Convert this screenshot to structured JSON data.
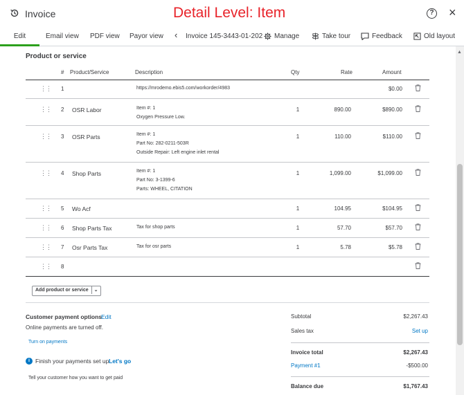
{
  "window": {
    "title": "Invoice",
    "overlay_text": "Detail Level: Item",
    "help_label": "?",
    "close_label": "×"
  },
  "toolbar": {
    "edit": "Edit",
    "email_view": "Email view",
    "pdf_view": "PDF view",
    "payor_view": "Payor view",
    "back_label": "‹",
    "invoice_number": "Invoice 145-3443-01-202",
    "manage": "Manage",
    "take_tour": "Take tour",
    "feedback": "Feedback",
    "old_layout": "Old layout"
  },
  "table": {
    "section_title": "Product or service",
    "headers": {
      "num": "#",
      "product": "Product/Service",
      "description": "Description",
      "qty": "Qty",
      "rate": "Rate",
      "amount": "Amount"
    },
    "rows": [
      {
        "num": "1",
        "product": "",
        "desc": [
          "https://mrodemo.ebis5.com/workorder/4983"
        ],
        "qty": "",
        "rate": "",
        "amount": "$0.00"
      },
      {
        "num": "2",
        "product": "OSR Labor",
        "desc": [
          "Item #: 1",
          "Oxygen Pressure Low."
        ],
        "qty": "1",
        "rate": "890.00",
        "amount": "$890.00"
      },
      {
        "num": "3",
        "product": "OSR Parts",
        "desc": [
          "Item #: 1",
          "Part No: 282-0211-503R",
          "Outside Repair: Left engine inlet rental"
        ],
        "qty": "1",
        "rate": "110.00",
        "amount": "$110.00"
      },
      {
        "num": "4",
        "product": "Shop Parts",
        "desc": [
          "Item #: 1",
          "Part No: 3-1399-6",
          "Parts: WHEEL, CITATION"
        ],
        "qty": "1",
        "rate": "1,099.00",
        "amount": "$1,099.00"
      },
      {
        "num": "5",
        "product": "Wo Acf",
        "desc": [],
        "qty": "1",
        "rate": "104.95",
        "amount": "$104.95"
      },
      {
        "num": "6",
        "product": "Shop Parts Tax",
        "desc": [
          "Tax for shop parts"
        ],
        "qty": "1",
        "rate": "57.70",
        "amount": "$57.70"
      },
      {
        "num": "7",
        "product": "Osr Parts Tax",
        "desc": [
          "Tax for osr parts"
        ],
        "qty": "1",
        "rate": "5.78",
        "amount": "$5.78"
      },
      {
        "num": "8",
        "product": "",
        "desc": [],
        "qty": "",
        "rate": "",
        "amount": ""
      }
    ],
    "add_button": "Add product or service",
    "add_caret": "⌄"
  },
  "payment": {
    "title": "Customer payment options",
    "edit": "Edit",
    "online_off": "Online payments are turned off.",
    "turn_on": "Turn on payments",
    "info_glyph": "i",
    "finish": "Finish your payments set up.",
    "lets_go": "Let's go",
    "tell": "Tell your customer how you want to get paid"
  },
  "totals": {
    "subtotal_label": "Subtotal",
    "subtotal_value": "$2,267.43",
    "sales_tax_label": "Sales tax",
    "sales_tax_action": "Set up",
    "invoice_total_label": "Invoice total",
    "invoice_total_value": "$2,267.43",
    "payment_label": "Payment #1",
    "payment_value": "-$500.00",
    "balance_label": "Balance due",
    "balance_value": "$1,767.43"
  },
  "colors": {
    "accent_green": "#2ca01c",
    "link_blue": "#0077c5",
    "overlay_red": "#e8232a"
  }
}
